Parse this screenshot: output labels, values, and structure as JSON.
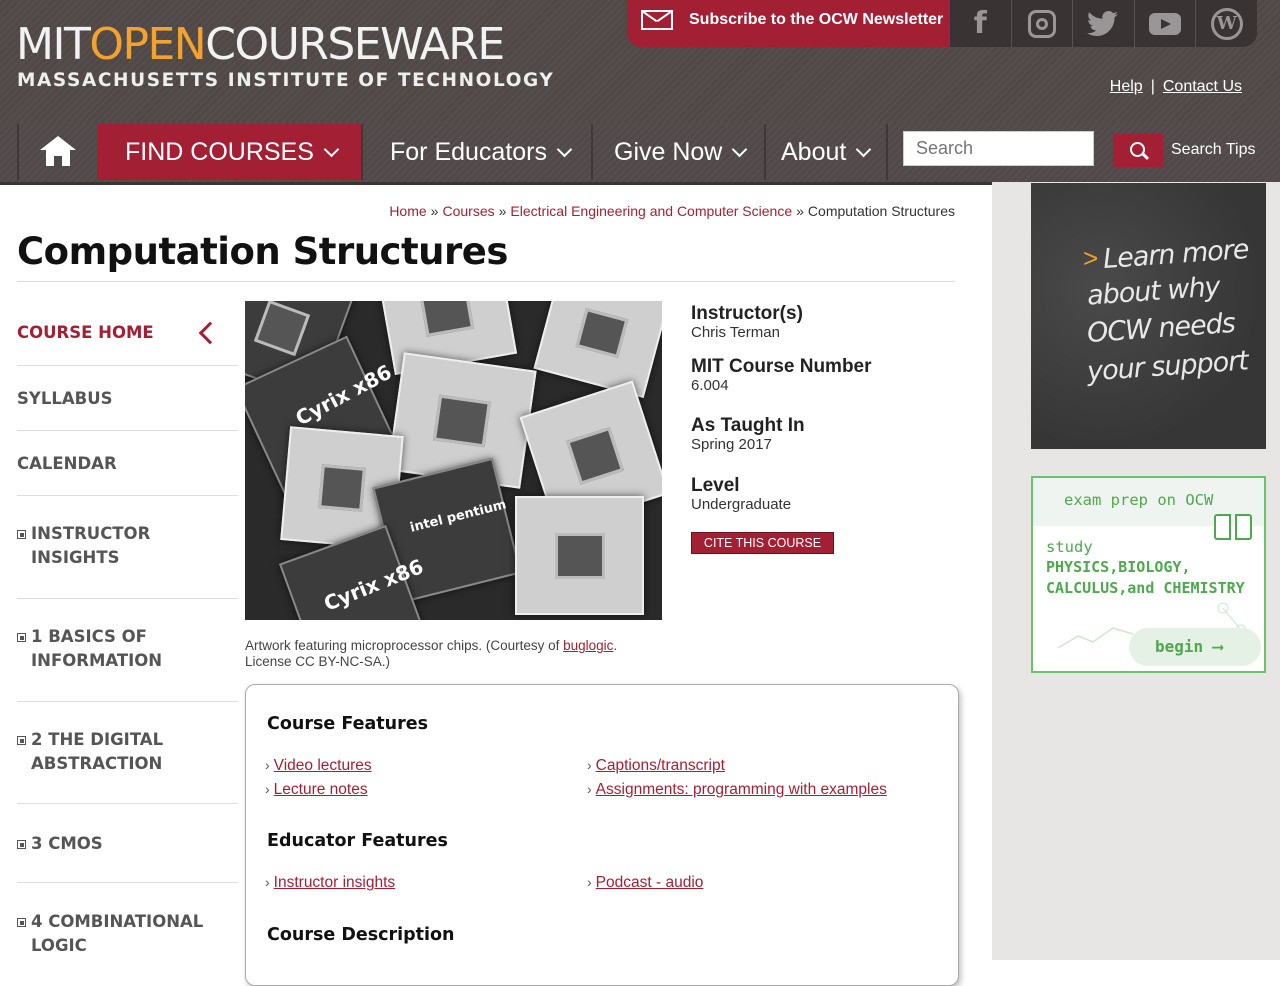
{
  "header": {
    "logo_mit": "MIT",
    "logo_open": "OPEN",
    "logo_courseware": "COURSEWARE",
    "logo_subtitle": "MASSACHUSETTS INSTITUTE OF TECHNOLOGY",
    "subscribe_label": "Subscribe to the OCW Newsletter",
    "social": [
      "facebook-icon",
      "instagram-icon",
      "twitter-icon",
      "youtube-icon",
      "wordpress-icon"
    ],
    "help_label": "Help",
    "contact_label": "Contact Us",
    "link_separator": "|"
  },
  "nav": {
    "items": [
      {
        "label": "FIND COURSES"
      },
      {
        "label": "For Educators"
      },
      {
        "label": "Give Now"
      },
      {
        "label": "About"
      }
    ],
    "search_placeholder": "Search",
    "search_tips_label": "Search Tips"
  },
  "breadcrumb": {
    "items": [
      "Home",
      "Courses",
      "Electrical Engineering and Computer Science"
    ],
    "current": "Computation Structures",
    "separator": "»"
  },
  "page": {
    "title": "Computation Structures"
  },
  "left_nav": {
    "items": [
      {
        "label": "COURSE HOME"
      },
      {
        "label": "SYLLABUS"
      },
      {
        "label": "CALENDAR"
      },
      {
        "label": "INSTRUCTOR INSIGHTS"
      },
      {
        "label": "1 BASICS OF INFORMATION"
      },
      {
        "label": "2 THE DIGITAL ABSTRACTION"
      },
      {
        "label": "3 CMOS"
      },
      {
        "label": "4 COMBINATIONAL LOGIC"
      }
    ]
  },
  "image": {
    "chip_labels": [
      "Cyrix x86",
      "intel pentium",
      "Cyrix x86"
    ],
    "caption_before": "Artwork featuring microprocessor chips. (Courtesy of ",
    "caption_link": "buglogic",
    "caption_after": ". License CC BY-NC-SA.)"
  },
  "info": {
    "instructor_label": "Instructor(s)",
    "instructor_value": "Chris Terman",
    "course_number_label": "MIT Course Number",
    "course_number_value": "6.004",
    "taught_label": "As Taught In",
    "taught_value": "Spring 2017",
    "level_label": "Level",
    "level_value": "Undergraduate",
    "cite_label": "CITE THIS COURSE"
  },
  "features": {
    "course_heading": "Course Features",
    "course_links": [
      "Video lectures",
      "Captions/transcript",
      "Lecture notes",
      "Assignments: programming with examples"
    ],
    "educator_heading": "Educator Features",
    "educator_links": [
      "Instructor insights",
      "Podcast - audio"
    ],
    "description_heading": "Course Description",
    "arrow": "›"
  },
  "sidebar": {
    "chalk_lines": [
      "Learn more",
      "about why",
      "OCW needs",
      "your support"
    ],
    "chalk_arrow": ">",
    "exam_title": "exam prep on OCW",
    "exam_study": "study",
    "exam_subjects": "PHYSICS,BIOLOGY, CALCULUS,and CHEMISTRY",
    "exam_button": "begin",
    "exam_button_arrow": "⟶"
  },
  "colors": {
    "brand_red": "#a31f34",
    "header_gray": "#4f4847",
    "logo_orange": "#f3a22f",
    "exam_green": "#4fa84f"
  }
}
